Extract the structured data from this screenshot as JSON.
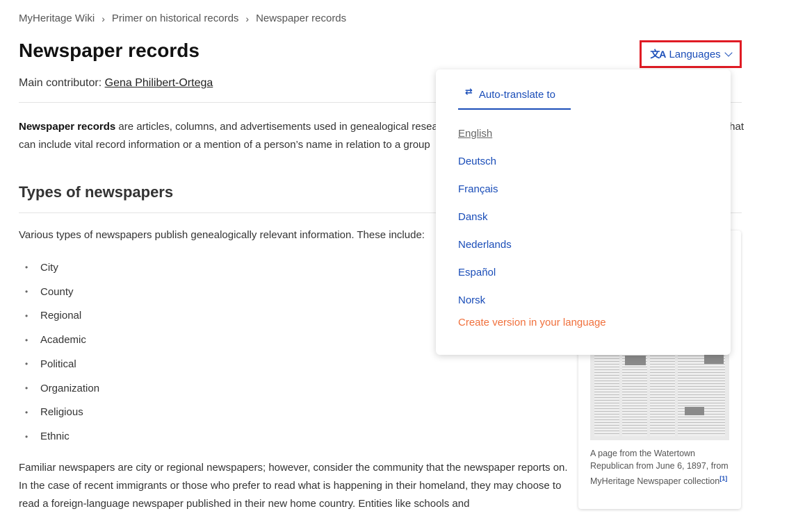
{
  "breadcrumb": [
    "MyHeritage Wiki",
    "Primer on historical records",
    "Newspaper records"
  ],
  "page_title": "Newspaper records",
  "contributor": {
    "label": "Main contributor:",
    "name": "Gena Philibert-Ortega"
  },
  "intro": {
    "bold": "Newspaper records",
    "line1": " are articles, columns, and advertisements used in genealogical resea",
    "line1_tail": "that",
    "line2": "can include vital record information or a mention of a person’s name in relation to a group"
  },
  "section": {
    "heading": "Types of newspapers",
    "intro": "Various types of newspapers publish genealogically relevant information. These include:",
    "bullet": "•",
    "items": [
      "City",
      "County",
      "Regional",
      "Academic",
      "Political",
      "Organization",
      "Religious",
      "Ethnic"
    ],
    "paragraph": "Familiar newspapers are city or regional newspapers; however, consider the community that the newspaper reports on. In the case of recent immigrants or those who prefer to read what is happening in their homeland, they may choose to read a foreign-language newspaper published in their new home country. Entities like schools and"
  },
  "image_card": {
    "caption": "A page from the Watertown Republican from June 6, 1897, from MyHeritage Newspaper collection",
    "ref": "[1]"
  },
  "languages_button": {
    "icon": "translate-icon",
    "glyph": "文A",
    "label": "Languages",
    "accent": "#1a4db8",
    "highlight": "#e01b24"
  },
  "dropdown": {
    "tab_icon_glyph": "⇄",
    "tab_label": "Auto-translate to",
    "current": "English",
    "languages": [
      "English",
      "Deutsch",
      "Français",
      "Dansk",
      "Nederlands",
      "Español",
      "Norsk"
    ],
    "create": "Create version in your language",
    "create_color": "#f0703c"
  }
}
